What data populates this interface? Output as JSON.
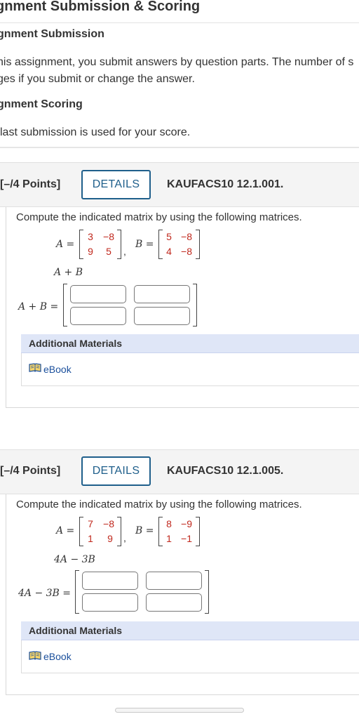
{
  "page": {
    "title": "gnment Submission & Scoring",
    "submission_heading": "gnment Submission",
    "submission_line1": "his assignment, you submit answers by question parts. The number of s",
    "submission_line2": "ges if you submit or change the answer.",
    "scoring_heading": "gnment Scoring",
    "scoring_line": "last submission is used for your score."
  },
  "questions": [
    {
      "points": "[–/4 Points]",
      "details_label": "DETAILS",
      "id": "KAUFACS10 12.1.001.",
      "prompt": "Compute the indicated matrix by using the following matrices.",
      "a_label": "A =",
      "b_label": "B =",
      "matrix_a": [
        "3",
        "−8",
        "9",
        "5"
      ],
      "matrix_b": [
        "5",
        "−8",
        "4",
        "−8"
      ],
      "expression": "A + B",
      "answer_label": "A + B =",
      "additional_materials": "Additional Materials",
      "ebook": "eBook"
    },
    {
      "points": "[–/4 Points]",
      "details_label": "DETAILS",
      "id": "KAUFACS10 12.1.005.",
      "prompt": "Compute the indicated matrix by using the following matrices.",
      "a_label": "A =",
      "b_label": "B =",
      "matrix_a": [
        "7",
        "−8",
        "1",
        "9"
      ],
      "matrix_b": [
        "8",
        "−9",
        "1",
        "−1"
      ],
      "expression": "4A − 3B",
      "answer_label": "4A − 3B =",
      "additional_materials": "Additional Materials",
      "ebook": "eBook"
    }
  ],
  "colors": {
    "accent": "#1f5f8b",
    "matrix_entry": "#c0281d",
    "link": "#1a4f9c",
    "materials_bar": "#dfe6f7"
  },
  "icons": [
    "book-icon"
  ]
}
